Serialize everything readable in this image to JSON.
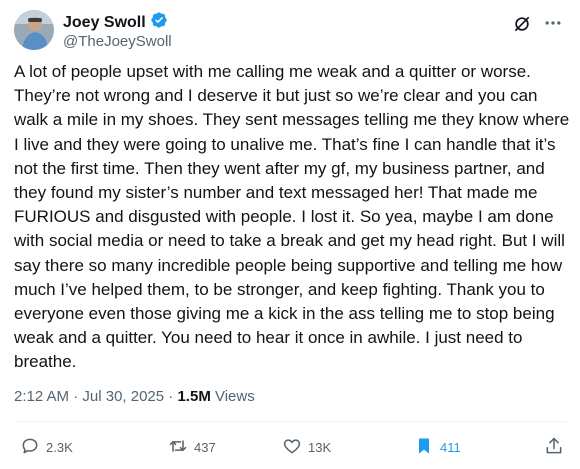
{
  "author": {
    "name": "Joey Swoll",
    "handle": "@TheJoeySwoll",
    "verified": true
  },
  "tweet": {
    "text": "A lot of people upset with me calling me weak and a quitter or worse. They’re not wrong and I deserve it but just so we’re clear and you can walk a mile in my shoes. They sent messages telling me they know where I live and they were going to unalive me. That’s fine I can handle that it’s not the first time. Then they went after my gf, my business partner, and they found my sister’s number and text messaged her! That made me FURIOUS and disgusted with people. I lost it. So yea, maybe I am done with social media or need to take a break and get my head right. But I will say there so many incredible people being supportive and telling me how much I’ve helped them, to be stronger, and keep fighting. Thank you to everyone even those giving me a kick in the ass telling me to stop being weak and a quitter. You need to hear it once in awhile. I just need to breathe.",
    "time": "2:12 AM",
    "separator": " · ",
    "date": "Jul 30, 2025",
    "views": "1.5M",
    "views_label": " Views"
  },
  "actions": {
    "replies": "2.3K",
    "reposts": "437",
    "likes": "13K",
    "bookmarks": "411"
  },
  "colors": {
    "text": "#0f1419",
    "secondary": "#536471",
    "verified": "#1d9bf0",
    "bookmark_active": "#1d9bf0"
  }
}
